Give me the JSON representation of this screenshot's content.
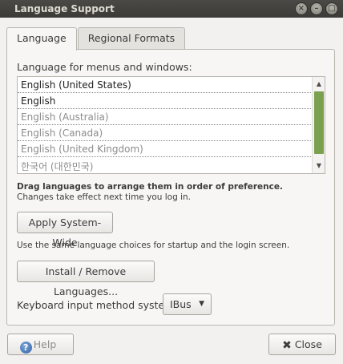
{
  "window": {
    "title": "Language Support",
    "controls": {
      "close": "×",
      "minimize": "–",
      "maximize": "□"
    }
  },
  "tabs": [
    {
      "label": "Language",
      "active": true
    },
    {
      "label": "Regional Formats",
      "active": false
    }
  ],
  "language_tab": {
    "list_label": "Language for menus and windows:",
    "languages": [
      {
        "name": "English (United States)",
        "enabled": true
      },
      {
        "name": "English",
        "enabled": true
      },
      {
        "name": "English (Australia)",
        "enabled": false
      },
      {
        "name": "English (Canada)",
        "enabled": false
      },
      {
        "name": "English (United Kingdom)",
        "enabled": false
      },
      {
        "name": "한국어 (대한민국)",
        "enabled": false
      }
    ],
    "drag_hint_bold": "Drag languages to arrange them in order of preference.",
    "drag_hint": "Changes take effect next time you log in.",
    "apply_button": "Apply System-Wide",
    "apply_description": "Use the same language choices for startup and the login screen.",
    "install_button": "Install / Remove Languages...",
    "keyboard_label": "Keyboard input method system:",
    "keyboard_value": "IBus"
  },
  "footer": {
    "help_button": "Help",
    "close_button": "Close"
  },
  "icons": {
    "help": "help-icon",
    "close": "close-icon",
    "dropdown": "chevron-down-icon",
    "scroll_up": "chevron-up-icon",
    "scroll_down": "chevron-down-icon"
  },
  "colors": {
    "titlebar": "#3c3b37",
    "scroll_thumb": "#7aa050",
    "window_bg": "#f2f1f0"
  }
}
